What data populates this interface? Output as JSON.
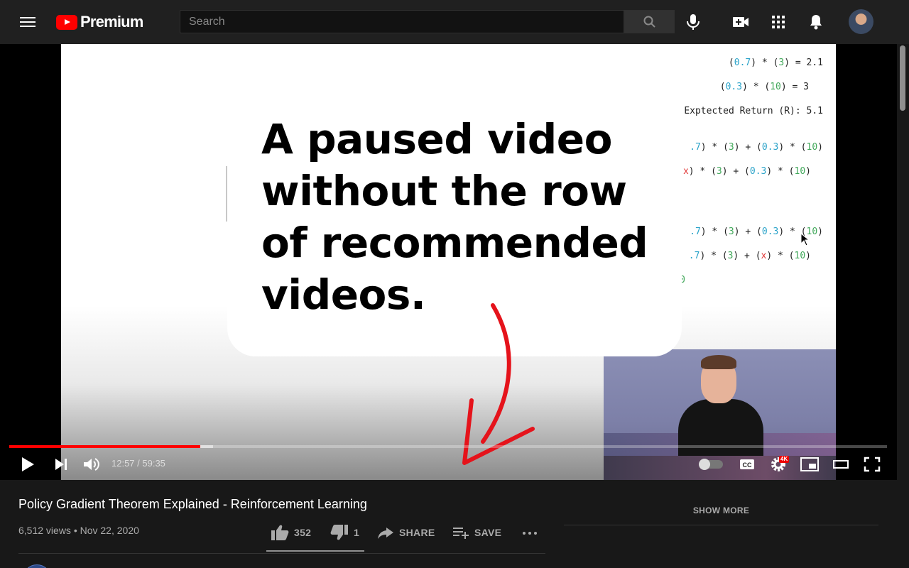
{
  "header": {
    "logo_text": "Premium",
    "search_placeholder": "Search"
  },
  "video": {
    "math_lines": [
      {
        "parts": [
          [
            "(",
            ""
          ],
          [
            "0.7",
            "b"
          ],
          [
            ") * (",
            ""
          ],
          [
            "3",
            "g"
          ],
          [
            ") = 2.1",
            ""
          ]
        ]
      },
      {
        "parts": [
          [
            "(",
            ""
          ],
          [
            "0.3",
            "b"
          ],
          [
            ") * (",
            ""
          ],
          [
            "10",
            "g"
          ],
          [
            ") = 3",
            ""
          ]
        ]
      },
      {
        "parts": [
          [
            "Exptected Return (R): 5.1",
            ""
          ]
        ]
      },
      {
        "parts": [
          [
            ".7",
            "b"
          ],
          [
            ") * (",
            ""
          ],
          [
            "3",
            "g"
          ],
          [
            ") + (",
            ""
          ],
          [
            "0.3",
            "b"
          ],
          [
            ") * (",
            ""
          ],
          [
            "10",
            "g"
          ],
          [
            ")",
            ""
          ]
        ]
      },
      {
        "parts": [
          [
            "x",
            "r"
          ],
          [
            ") * (",
            ""
          ],
          [
            "3",
            "g"
          ],
          [
            ") + (",
            ""
          ],
          [
            "0.3",
            "b"
          ],
          [
            ") * (",
            ""
          ],
          [
            "10",
            "g"
          ],
          [
            ")",
            ""
          ]
        ]
      },
      {
        "parts": [
          [
            ".7",
            "b"
          ],
          [
            ") * (",
            ""
          ],
          [
            "3",
            "g"
          ],
          [
            ") + (",
            ""
          ],
          [
            "0.3",
            "b"
          ],
          [
            ") * (",
            ""
          ],
          [
            "10",
            "g"
          ],
          [
            ")",
            ""
          ]
        ]
      },
      {
        "parts": [
          [
            ".7",
            "b"
          ],
          [
            ") * (",
            ""
          ],
          [
            "3",
            "g"
          ],
          [
            ") + (",
            ""
          ],
          [
            "x",
            "r"
          ],
          [
            ") * (",
            ""
          ],
          [
            "10",
            "g"
          ],
          [
            ")",
            ""
          ]
        ]
      },
      {
        "parts": [
          [
            "0",
            "g"
          ]
        ]
      }
    ]
  },
  "callout": {
    "text": "A paused video without the row of recommended videos."
  },
  "player": {
    "time": "12:57 / 59:35",
    "progress_played": 0.218,
    "progress_buffered": 0.232,
    "quality_badge": "4K",
    "accent_color": "#ff0000"
  },
  "info": {
    "title": "Policy Gradient Theorem Explained - Reinforcement Learning",
    "meta": "6,512 views • Nov 22, 2020",
    "likes": "352",
    "dislikes": "1",
    "share_label": "SHARE",
    "save_label": "SAVE",
    "show_more_label": "SHOW MORE"
  }
}
